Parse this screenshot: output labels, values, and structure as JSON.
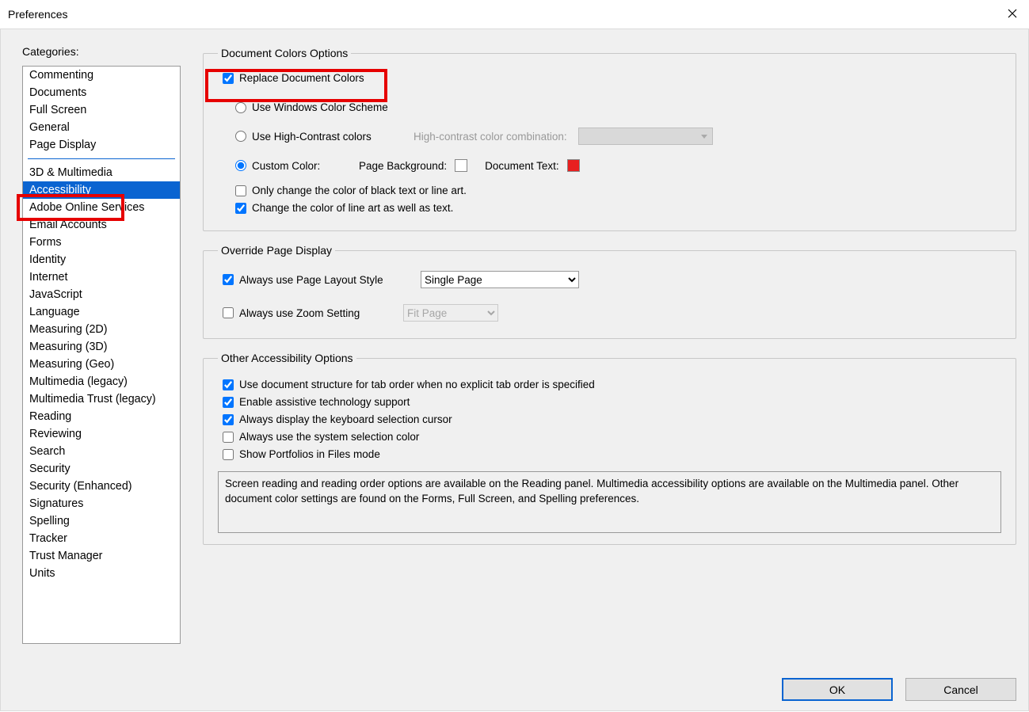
{
  "window": {
    "title": "Preferences"
  },
  "sidebar": {
    "label": "Categories:",
    "group1": [
      "Commenting",
      "Documents",
      "Full Screen",
      "General",
      "Page Display"
    ],
    "group2": [
      "3D & Multimedia",
      "Accessibility",
      "Adobe Online Services",
      "Email Accounts",
      "Forms",
      "Identity",
      "Internet",
      "JavaScript",
      "Language",
      "Measuring (2D)",
      "Measuring (3D)",
      "Measuring (Geo)",
      "Multimedia (legacy)",
      "Multimedia Trust (legacy)",
      "Reading",
      "Reviewing",
      "Search",
      "Security",
      "Security (Enhanced)",
      "Signatures",
      "Spelling",
      "Tracker",
      "Trust Manager",
      "Units"
    ],
    "selected": "Accessibility"
  },
  "docColors": {
    "legend": "Document Colors Options",
    "replaceDoc": "Replace Document Colors",
    "useWindows": "Use Windows Color Scheme",
    "useHighContrast": "Use High-Contrast colors",
    "highContrastLabel": "High-contrast color combination:",
    "customColor": "Custom Color:",
    "pageBg": "Page Background:",
    "docText": "Document Text:",
    "onlyBlack": "Only change the color of black text or line art.",
    "lineArt": "Change the color of line art as well as text."
  },
  "overridePage": {
    "legend": "Override Page Display",
    "pageLayout": "Always use Page Layout Style",
    "pageLayoutValue": "Single Page",
    "zoom": "Always use Zoom Setting",
    "zoomValue": "Fit Page"
  },
  "otherAcc": {
    "legend": "Other Accessibility Options",
    "tabOrder": "Use document structure for tab order when no explicit tab order is specified",
    "assistive": "Enable assistive technology support",
    "keyboardCursor": "Always display the keyboard selection cursor",
    "systemSelColor": "Always use the system selection color",
    "portfolios": "Show Portfolios in Files mode",
    "info": "Screen reading and reading order options are available on the Reading panel. Multimedia accessibility options are available on the Multimedia panel. Other document color settings are found on the Forms, Full Screen, and Spelling preferences."
  },
  "footer": {
    "ok": "OK",
    "cancel": "Cancel"
  }
}
